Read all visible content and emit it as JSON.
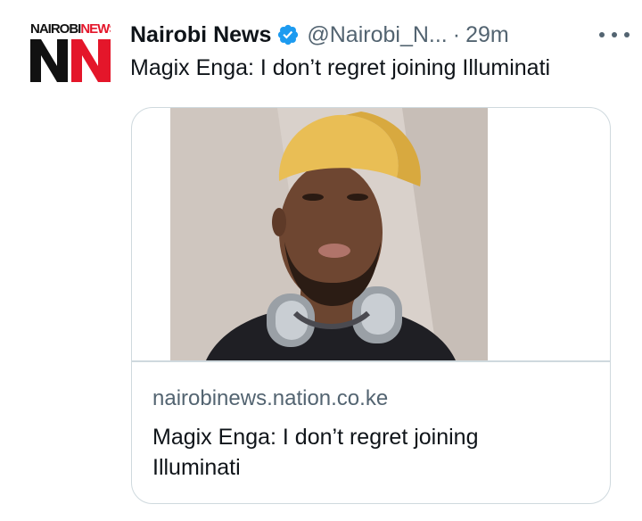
{
  "account": {
    "display_name": "Nairobi News",
    "handle": "@Nairobi_N...",
    "separator": "·",
    "time": "29m",
    "avatar_text_dark": "NAIROBI",
    "avatar_text_accent": "NEWS",
    "verified": true
  },
  "tweet": {
    "text": "Magix Enga: I don’t regret joining Illuminati"
  },
  "card": {
    "domain": "nairobinews.nation.co.ke",
    "title": "Magix Enga: I don’t regret joining Illuminati"
  },
  "colors": {
    "brand_red": "#e4162a",
    "verified_blue": "#1d9bf0",
    "secondary_text": "#536471",
    "border": "#cfd9de"
  },
  "icons": {
    "verified": "verified-badge-icon",
    "more": "more-horizontal-icon"
  }
}
